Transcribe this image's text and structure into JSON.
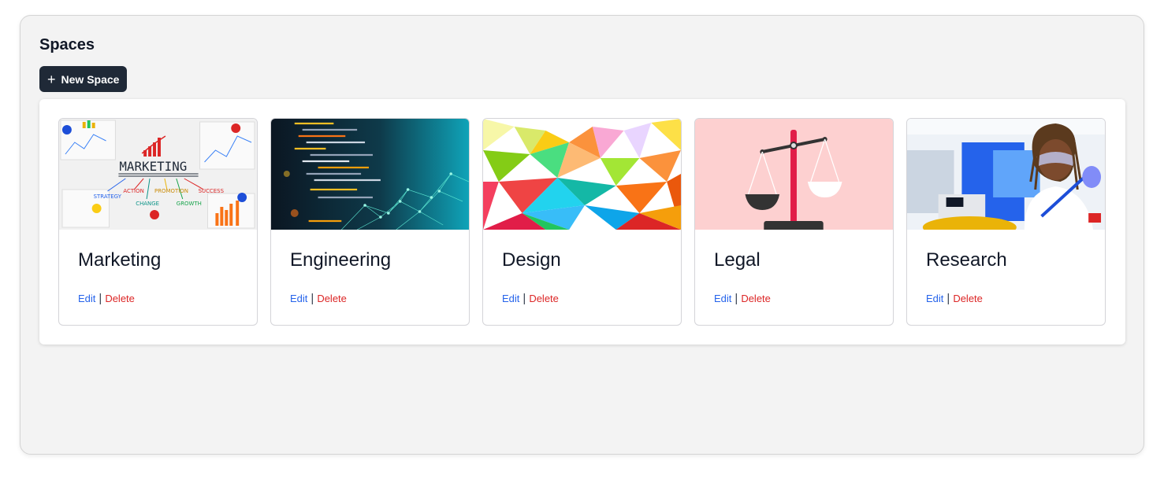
{
  "page": {
    "title": "Spaces",
    "new_button_label": "New Space",
    "new_button_icon": "plus-icon"
  },
  "cards": [
    {
      "name": "Marketing",
      "image": "marketing-whiteboard-image",
      "image_text": {
        "word": "MARKETING",
        "branches": [
          "STRATEGY",
          "ACTION",
          "PROMOTION",
          "SUCCESS",
          "CHANGE",
          "GROWTH"
        ]
      },
      "edit_label": "Edit",
      "delete_label": "Delete"
    },
    {
      "name": "Engineering",
      "image": "code-network-image",
      "edit_label": "Edit",
      "delete_label": "Delete"
    },
    {
      "name": "Design",
      "image": "polygon-art-image",
      "edit_label": "Edit",
      "delete_label": "Delete"
    },
    {
      "name": "Legal",
      "image": "scales-of-justice-image",
      "edit_label": "Edit",
      "delete_label": "Delete"
    },
    {
      "name": "Research",
      "image": "lab-scientist-image",
      "edit_label": "Edit",
      "delete_label": "Delete"
    }
  ],
  "colors": {
    "edit": "#2563eb",
    "delete": "#dc2626",
    "button_bg": "#1f2937",
    "legal_bg": "#fdd0d0"
  }
}
